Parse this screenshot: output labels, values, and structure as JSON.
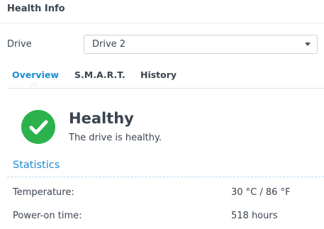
{
  "window": {
    "title": "Health Info"
  },
  "drive": {
    "label": "Drive",
    "selected": "Drive 2"
  },
  "tabs": [
    {
      "label": "Overview",
      "active": true
    },
    {
      "label": "S.M.A.R.T.",
      "active": false
    },
    {
      "label": "History",
      "active": false
    }
  ],
  "status": {
    "title": "Healthy",
    "description": "The drive is healthy.",
    "icon": "check-circle-icon",
    "color": "#2bb24c"
  },
  "statistics": {
    "title": "Statistics",
    "rows": [
      {
        "label": "Temperature:",
        "value": "30 °C / 86 °F"
      },
      {
        "label": "Power-on time:",
        "value": "518 hours"
      }
    ]
  },
  "colors": {
    "accent": "#1a8cd0",
    "healthy": "#2bb24c"
  }
}
